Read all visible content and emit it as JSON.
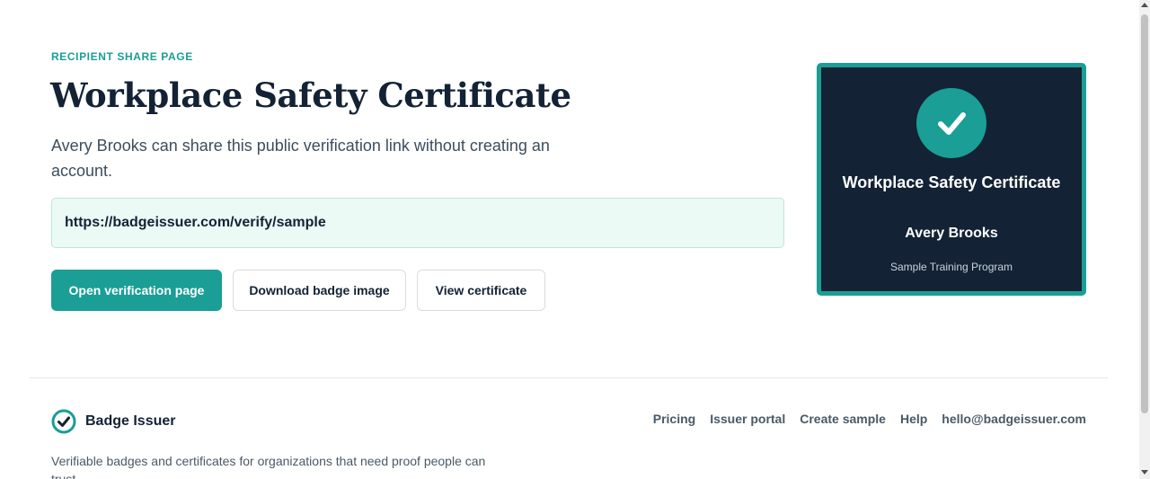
{
  "page": {
    "eyebrow": "RECIPIENT SHARE PAGE",
    "title": "Workplace Safety Certificate",
    "lead": "Avery Brooks can share this public verification link without creating an account."
  },
  "share": {
    "url": "https://badgeissuer.com/verify/sample"
  },
  "actions": {
    "open_label": "Open verification page",
    "download_label": "Download badge image",
    "view_label": "View certificate"
  },
  "badge": {
    "icon": "checkmark-icon",
    "title": "Workplace Safety Certificate",
    "recipient": "Avery Brooks",
    "program": "Sample Training Program"
  },
  "footer": {
    "brand": "Badge Issuer",
    "brand_icon": "check-circle-icon",
    "tagline": "Verifiable badges and certificates for organizations that need proof people can trust.",
    "links": [
      "Pricing",
      "Issuer portal",
      "Create sample",
      "Help",
      "hello@badgeissuer.com"
    ]
  },
  "colors": {
    "accent": "#1a9e95",
    "navy": "#132235",
    "url_bg": "#ebfaf5"
  }
}
